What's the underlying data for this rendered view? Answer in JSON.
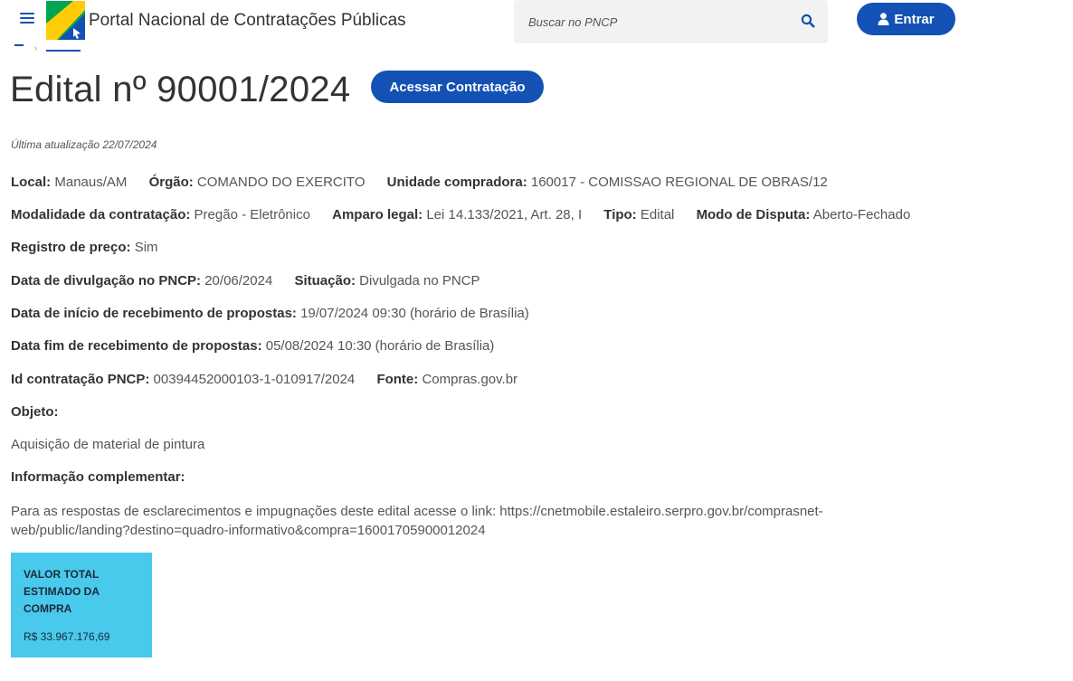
{
  "header": {
    "site_title": "Portal Nacional de Contratações Públicas",
    "search_placeholder": "Buscar no PNCP",
    "login_label": "Entrar",
    "menu_icon": "hamburger-menu-icon",
    "search_icon": "search-icon",
    "user_icon": "user-icon",
    "brand_colors": {
      "primary": "#1351b4",
      "green": "#00a650",
      "yellow": "#ffcd07"
    }
  },
  "page": {
    "title": "Edital nº 90001/2024",
    "access_button": "Acessar Contratação",
    "last_update": "Última atualização 22/07/2024"
  },
  "details": {
    "local_label": "Local:",
    "local_value": "Manaus/AM",
    "orgao_label": "Órgão:",
    "orgao_value": "COMANDO DO EXERCITO",
    "unidade_label": "Unidade compradora:",
    "unidade_value": "160017 - COMISSAO REGIONAL DE OBRAS/12",
    "modalidade_label": "Modalidade da contratação:",
    "modalidade_value": "Pregão - Eletrônico",
    "amparo_label": "Amparo legal:",
    "amparo_value": "Lei 14.133/2021, Art. 28, I",
    "tipo_label": "Tipo:",
    "tipo_value": "Edital",
    "disputa_label": "Modo de Disputa:",
    "disputa_value": "Aberto-Fechado",
    "registro_label": "Registro de preço:",
    "registro_value": "Sim",
    "divulgacao_label": "Data de divulgação no PNCP:",
    "divulgacao_value": "20/06/2024",
    "situacao_label": "Situação:",
    "situacao_value": "Divulgada no PNCP",
    "inicio_label": "Data de início de recebimento de propostas:",
    "inicio_value": "19/07/2024 09:30 (horário de Brasília)",
    "fim_label": "Data fim de recebimento de propostas:",
    "fim_value": "05/08/2024 10:30 (horário de Brasília)",
    "id_label": "Id contratação PNCP:",
    "id_value": "00394452000103-1-010917/2024",
    "fonte_label": "Fonte:",
    "fonte_value": "Compras.gov.br",
    "objeto_label": "Objeto:",
    "objeto_value": "Aquisição de material de pintura",
    "info_label": "Informação complementar:",
    "info_value": "Para as respostas de esclarecimentos e impugnações deste edital acesse o link: https://cnetmobile.estaleiro.serpro.gov.br/comprasnet-web/public/landing?destino=quadro-informativo&compra=16001705900012024"
  },
  "value_card": {
    "label": "VALOR TOTAL ESTIMADO DA COMPRA",
    "amount": "R$ 33.967.176,69",
    "color": "#49c9ec"
  }
}
